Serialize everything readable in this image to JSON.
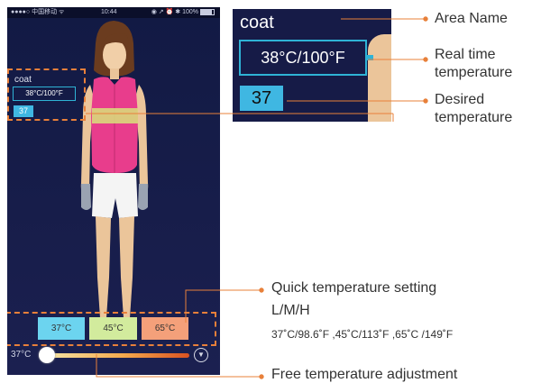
{
  "status_bar": {
    "carrier": "●●●●○ 中国移动 ᯤ",
    "time": "10:44",
    "right": "◉ ↗ ⏰ ✱ 100%"
  },
  "screen": {
    "area_name": "coat",
    "realtime_temp": "38°C/100°F",
    "desired_temp": "37",
    "quick_buttons": [
      "37°C",
      "45°C",
      "65°C"
    ],
    "slider_label": "37°C",
    "dropdown_icon": "chevron-down-icon"
  },
  "zoom": {
    "area_name": "coat",
    "realtime_temp": "38°C/100°F",
    "desired_temp": "37"
  },
  "annotations": {
    "area_name": "Area Name",
    "realtime_1": "Real time",
    "realtime_2": "temperature",
    "desired_1": "Desired",
    "desired_2": "temperature",
    "quick_1": "Quick temperature setting",
    "quick_2": "L/M/H",
    "quick_values": "37˚C/98.6˚F ,45˚C/113˚F ,65˚C /149˚F",
    "free": "Free temperature adjustment"
  },
  "colors": {
    "accent_orange": "#e8803a",
    "cyan": "#3fb7e2",
    "background_navy": "#161b47",
    "vest_pink": "#e83d8c"
  }
}
